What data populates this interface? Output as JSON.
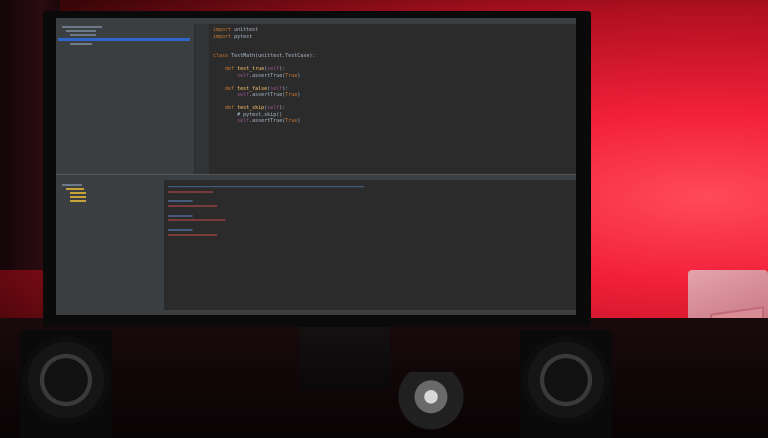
{
  "editor": {
    "lines": [
      {
        "parts": [
          [
            "kw",
            "import "
          ],
          [
            "plain",
            "unittest"
          ]
        ]
      },
      {
        "parts": [
          [
            "kw",
            "import "
          ],
          [
            "plain",
            "pytest"
          ]
        ]
      },
      {
        "parts": [
          [
            "plain",
            ""
          ]
        ]
      },
      {
        "parts": [
          [
            "plain",
            ""
          ]
        ]
      },
      {
        "parts": [
          [
            "kw",
            "class "
          ],
          [
            "plain",
            "TestMath(unittest.TestCase):"
          ]
        ]
      },
      {
        "parts": [
          [
            "plain",
            ""
          ]
        ]
      },
      {
        "parts": [
          [
            "plain",
            "    "
          ],
          [
            "kw",
            "def "
          ],
          [
            "fn",
            "test_true"
          ],
          [
            "plain",
            "("
          ],
          [
            "self",
            "self"
          ],
          [
            "plain",
            "):"
          ]
        ]
      },
      {
        "parts": [
          [
            "plain",
            "        "
          ],
          [
            "self",
            "self"
          ],
          [
            "plain",
            ".assertTrue("
          ],
          [
            "bool",
            "True"
          ],
          [
            "plain",
            ")"
          ]
        ]
      },
      {
        "parts": [
          [
            "plain",
            ""
          ]
        ]
      },
      {
        "parts": [
          [
            "plain",
            "    "
          ],
          [
            "kw",
            "def "
          ],
          [
            "fn",
            "test_false"
          ],
          [
            "plain",
            "("
          ],
          [
            "self",
            "self"
          ],
          [
            "plain",
            "):"
          ]
        ]
      },
      {
        "parts": [
          [
            "plain",
            "        "
          ],
          [
            "self",
            "self"
          ],
          [
            "plain",
            ".assertTrue("
          ],
          [
            "bool",
            "True"
          ],
          [
            "plain",
            ")"
          ]
        ]
      },
      {
        "parts": [
          [
            "plain",
            ""
          ]
        ]
      },
      {
        "parts": [
          [
            "plain",
            "    "
          ],
          [
            "kw",
            "def "
          ],
          [
            "fn",
            "test_skip"
          ],
          [
            "plain",
            "("
          ],
          [
            "self",
            "self"
          ],
          [
            "plain",
            "):"
          ]
        ]
      },
      {
        "parts": [
          [
            "plain",
            "        # pytest.skip()"
          ]
        ]
      },
      {
        "parts": [
          [
            "plain",
            "        "
          ],
          [
            "self",
            "self"
          ],
          [
            "plain",
            ".assertTrue("
          ],
          [
            "bool",
            "True"
          ],
          [
            "plain",
            ")"
          ]
        ]
      }
    ]
  }
}
